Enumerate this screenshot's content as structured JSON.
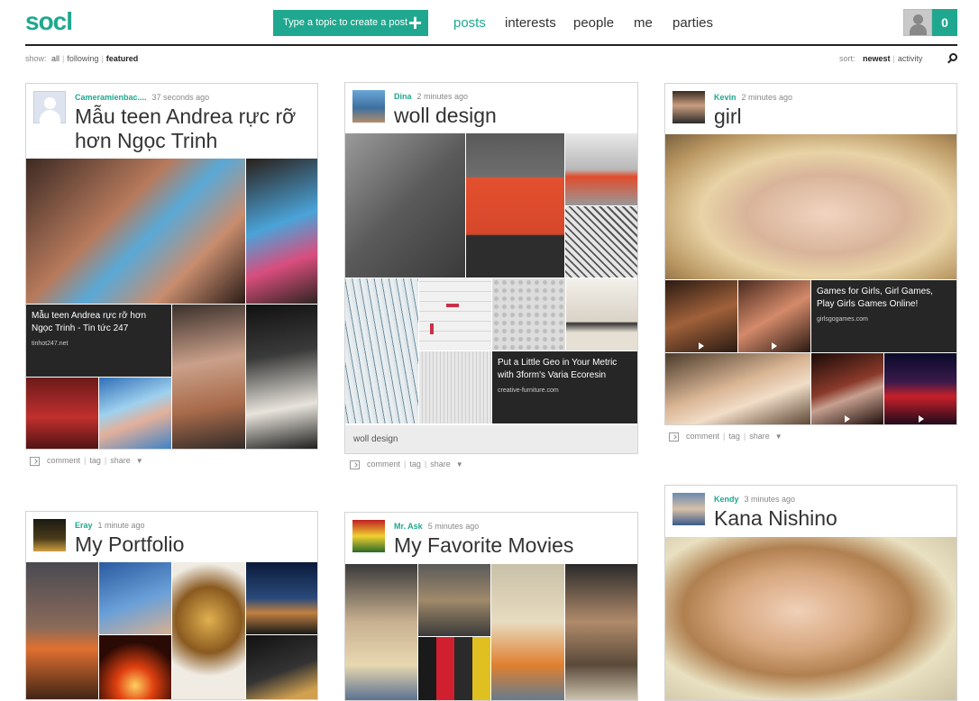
{
  "header": {
    "logo": "socl",
    "create_placeholder": "Type a topic to create a post",
    "nav": [
      "posts",
      "interests",
      "people",
      "me",
      "parties"
    ],
    "notification_count": "0"
  },
  "filters": {
    "label": "show:",
    "options": [
      "all",
      "following",
      "featured"
    ],
    "selected": "featured"
  },
  "sort": {
    "label": "sort:",
    "options": [
      "newest",
      "activity"
    ],
    "selected": "newest"
  },
  "colors": {
    "accent": "#1fa88f",
    "rule": "#222222"
  },
  "icons": [
    "plus-icon",
    "avatar-icon",
    "search-icon",
    "comment-icon",
    "dropdown-arrow-icon",
    "play-icon"
  ],
  "actions": {
    "comment": "comment",
    "tag": "tag",
    "share": "share"
  },
  "posts": [
    {
      "author": "Cameramienbac....",
      "time": "37 seconds ago",
      "title": "Mẫu teen Andrea rực rỡ hơn Ngọc Trinh",
      "link": {
        "title": "Mẫu teen Andrea rực rỡ hơn Ngọc Trinh - Tin tức 247",
        "domain": "tinhot247.net"
      }
    },
    {
      "author": "Dina",
      "time": "2 minutes ago",
      "title": "woll design",
      "link": {
        "title": "Put a Little Geo in Your Metric with 3form's Varia Ecoresin",
        "domain": "creative-furniture.com"
      },
      "caption": "woll design"
    },
    {
      "author": "Kevin",
      "time": "2 minutes ago",
      "title": "girl",
      "link": {
        "title": "Games for Girls, Girl Games, Play Girls Games Online!",
        "domain": "girlsgogames.com"
      }
    },
    {
      "author": "Eray",
      "time": "1 minute ago",
      "title": "My Portfolio"
    },
    {
      "author": "Mr. Ask",
      "time": "5 minutes ago",
      "title": "My Favorite Movies"
    },
    {
      "author": "Kendy",
      "time": "3 minutes ago",
      "title": "Kana Nishino"
    }
  ]
}
